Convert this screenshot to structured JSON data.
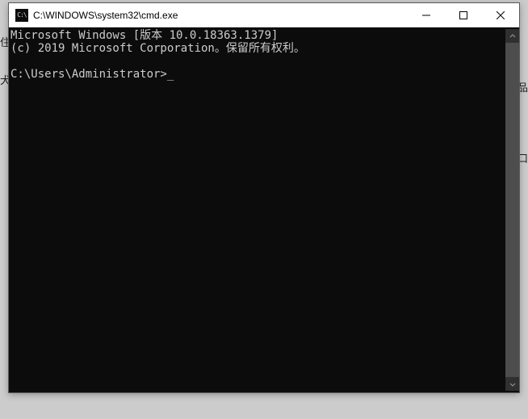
{
  "window": {
    "icon_text": "C:\\",
    "title": "C:\\WINDOWS\\system32\\cmd.exe"
  },
  "console": {
    "line1": "Microsoft Windows [版本 10.0.18363.1379]",
    "line2": "(c) 2019 Microsoft Corporation。保留所有权利。",
    "blank": "",
    "prompt": "C:\\Users\\Administrator>",
    "caret": "_"
  },
  "bg": {
    "left1": "住",
    "left2": "犬",
    "right1": "品",
    "right2": "口"
  }
}
